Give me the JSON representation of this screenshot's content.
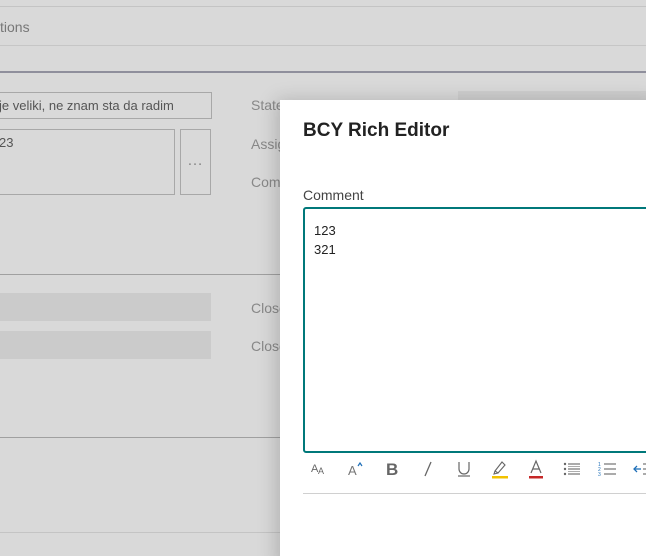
{
  "background": {
    "actions_label": "tions",
    "title_value": "je veliki, ne znam sta da radim",
    "description_value": "23",
    "more_button_label": "…",
    "side_labels": {
      "state": "State",
      "assigned": "Assig",
      "comment": "Com",
      "close_1": "Close",
      "close_2": "Close"
    }
  },
  "dialog": {
    "title": "BCY Rich Editor",
    "comment_label": "Comment",
    "comment_lines": [
      "123",
      "321"
    ]
  },
  "toolbar": {
    "icons": [
      "font-size-icon",
      "superscript-icon",
      "bold-icon",
      "italic-icon",
      "underline-icon",
      "highlight-icon",
      "font-color-icon",
      "bullet-list-icon",
      "numbered-list-icon",
      "outdent-icon"
    ]
  },
  "colors": {
    "accent": "#00787a",
    "highlight": "#f2c200",
    "font_color": "#c62828",
    "outdent": "#1e6fb8"
  }
}
